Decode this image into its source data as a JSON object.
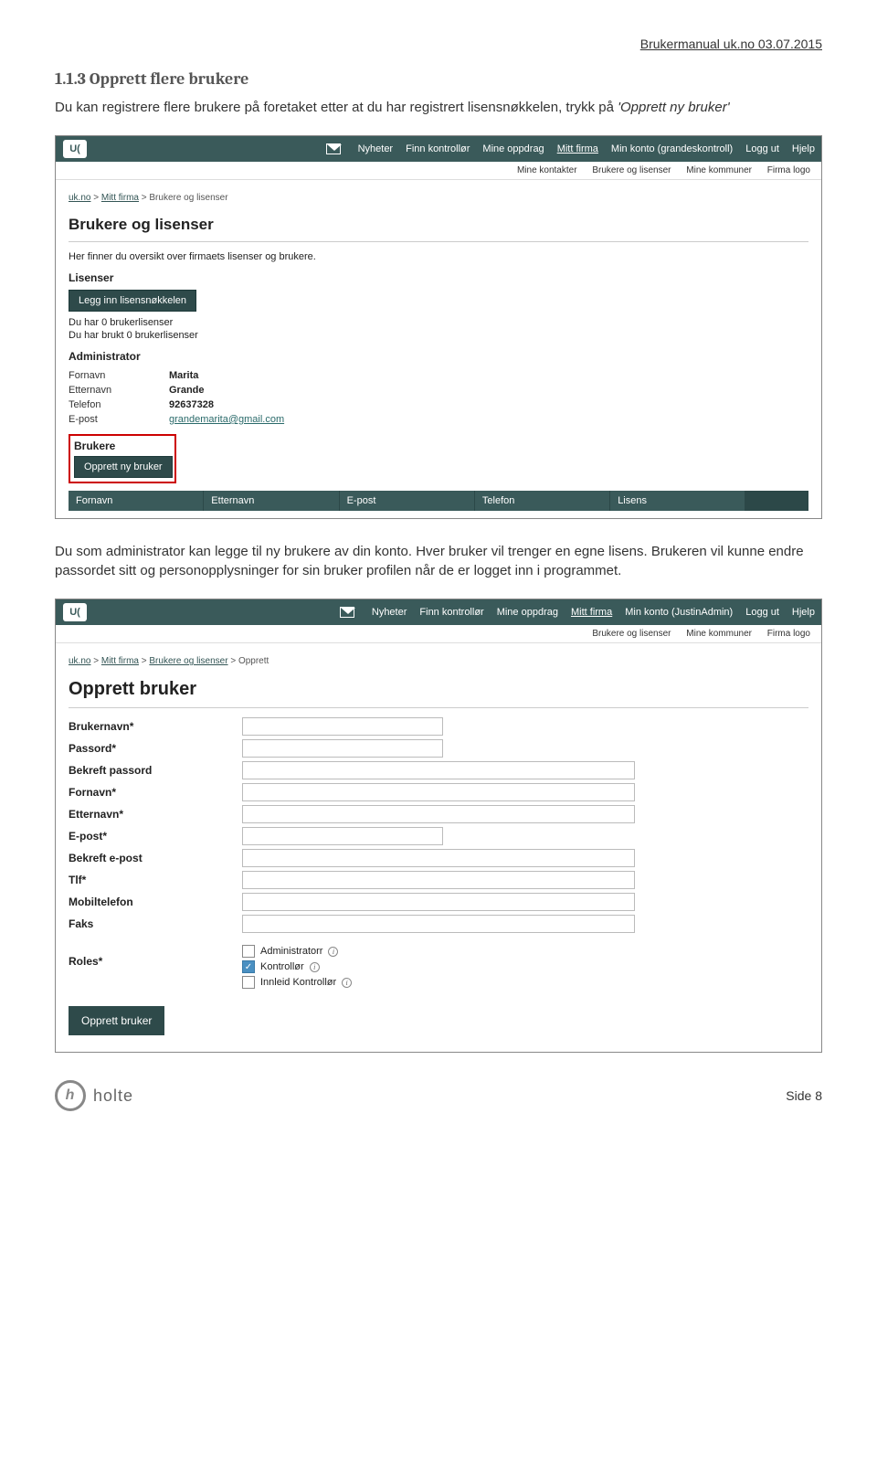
{
  "doc_header": "Brukermanual uk.no 03.07.2015",
  "section_heading": "1.1.3  Opprett flere brukere",
  "intro_1": "Du kan registrere flere brukere på foretaket etter at du har registrert lisensnøkkelen, trykk på ",
  "intro_ref": "'Opprett ny bruker'",
  "between_1": "Du som administrator kan legge til ny brukere av din konto. Hver bruker vil trenger en egne lisens. Brukeren vil kunne endre passordet sitt og personopplysninger for sin bruker profilen når de er logget inn i programmet.",
  "page_num": "Side 8",
  "holte": "holte",
  "holte_h": "h",
  "shot1": {
    "logo": "U(",
    "nav": {
      "nyheter": "Nyheter",
      "finn": "Finn kontrollør",
      "oppdrag": "Mine oppdrag",
      "firma": "Mitt firma",
      "konto": "Min konto (grandeskontroll)",
      "logg": "Logg ut",
      "hjelp": "Hjelp"
    },
    "subnav": {
      "kontakter": "Mine kontakter",
      "brukere": "Brukere og lisenser",
      "kommuner": "Mine kommuner",
      "logo": "Firma logo"
    },
    "breadcrumb": {
      "a": "uk.no",
      "b": "Mitt firma",
      "c": "Brukere og lisenser"
    },
    "title": "Brukere og lisenser",
    "desc": "Her finner du oversikt over firmaets lisenser og brukere.",
    "lisenser_lbl": "Lisenser",
    "legg_btn": "Legg inn lisensnøkkelen",
    "count1": "Du har 0 brukerlisenser",
    "count2": "Du har brukt 0 brukerlisenser",
    "admin_lbl": "Administrator",
    "admin": {
      "fornavn_k": "Fornavn",
      "fornavn_v": "Marita",
      "etternavn_k": "Etternavn",
      "etternavn_v": "Grande",
      "telefon_k": "Telefon",
      "telefon_v": "92637328",
      "epost_k": "E-post",
      "epost_v": "grandemarita@gmail.com"
    },
    "brukere_lbl": "Brukere",
    "opprett_btn": "Opprett ny bruker",
    "tbl": {
      "c1": "Fornavn",
      "c2": "Etternavn",
      "c3": "E-post",
      "c4": "Telefon",
      "c5": "Lisens"
    }
  },
  "shot2": {
    "logo": "U(",
    "nav": {
      "nyheter": "Nyheter",
      "finn": "Finn kontrollør",
      "oppdrag": "Mine oppdrag",
      "firma": "Mitt firma",
      "konto": "Min konto (JustinAdmin)",
      "logg": "Logg ut",
      "hjelp": "Hjelp"
    },
    "subnav": {
      "brukere": "Brukere og lisenser",
      "kommuner": "Mine kommuner",
      "logo": "Firma logo"
    },
    "breadcrumb": {
      "a": "uk.no",
      "b": "Mitt firma",
      "c": "Brukere og lisenser",
      "d": "Opprett"
    },
    "title": "Opprett bruker",
    "fields": {
      "brukernavn": "Brukernavn*",
      "passord": "Passord*",
      "bekreft_p": "Bekreft passord",
      "fornavn": "Fornavn*",
      "etternavn": "Etternavn*",
      "epost": "E-post*",
      "bekreft_e": "Bekreft e-post",
      "tlf": "Tlf*",
      "mobil": "Mobiltelefon",
      "faks": "Faks",
      "roles": "Roles*"
    },
    "role_opts": {
      "admin": "Administratorr",
      "kontrollor": "Kontrollør",
      "innleid": "Innleid Kontrollør"
    },
    "submit": "Opprett bruker"
  }
}
